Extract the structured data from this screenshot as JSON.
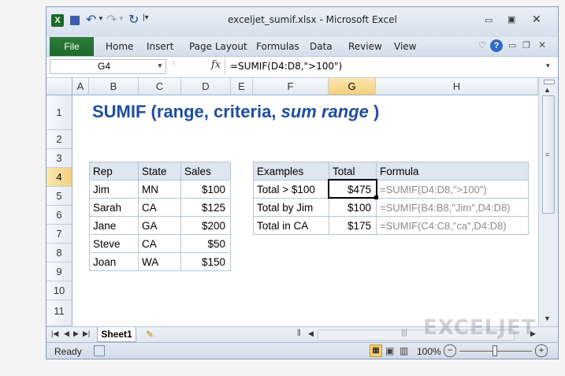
{
  "window": {
    "title": "exceljet_sumif.xlsx - Microsoft Excel"
  },
  "ribbon": {
    "tabs": [
      "File",
      "Home",
      "Insert",
      "Page Layout",
      "Formulas",
      "Data",
      "Review",
      "View"
    ]
  },
  "formula_bar": {
    "name_box": "G4",
    "fx": "fx",
    "formula": "=SUMIF(D4:D8,\">100\")"
  },
  "columns": [
    "A",
    "B",
    "C",
    "D",
    "E",
    "F",
    "G",
    "H"
  ],
  "selected_column": "G",
  "rows": [
    "1",
    "2",
    "3",
    "4",
    "5",
    "6",
    "7",
    "8",
    "9",
    "10",
    "11"
  ],
  "selected_row": "4",
  "sheet_title": {
    "main": "SUMIF (range, criteria, ",
    "italic": "sum range",
    "close": " )"
  },
  "data_table": {
    "headers": [
      "Rep",
      "State",
      "Sales"
    ],
    "rows": [
      [
        "Jim",
        "MN",
        "$100"
      ],
      [
        "Sarah",
        "CA",
        "$125"
      ],
      [
        "Jane",
        "GA",
        "$200"
      ],
      [
        "Steve",
        "CA",
        "$50"
      ],
      [
        "Joan",
        "WA",
        "$150"
      ]
    ]
  },
  "examples_table": {
    "headers": [
      "Examples",
      "Total",
      "Formula"
    ],
    "rows": [
      [
        "Total > $100",
        "$475",
        "=SUMIF(D4:D8,\">100\")"
      ],
      [
        "Total by Jim",
        "$100",
        "=SUMIF(B4:B8,\"Jim\",D4:D8)"
      ],
      [
        "Total in CA",
        "$175",
        "=SUMIF(C4:C8,\"ca\",D4:D8)"
      ]
    ]
  },
  "sheet_tabs": {
    "active": "Sheet1"
  },
  "status": {
    "ready": "Ready",
    "zoom": "100%"
  },
  "watermark": "EXCELJET",
  "colors": {
    "title_blue": "#1f4e9c",
    "excel_green": "#1d6a2a",
    "selection": "#f4cf7a"
  }
}
